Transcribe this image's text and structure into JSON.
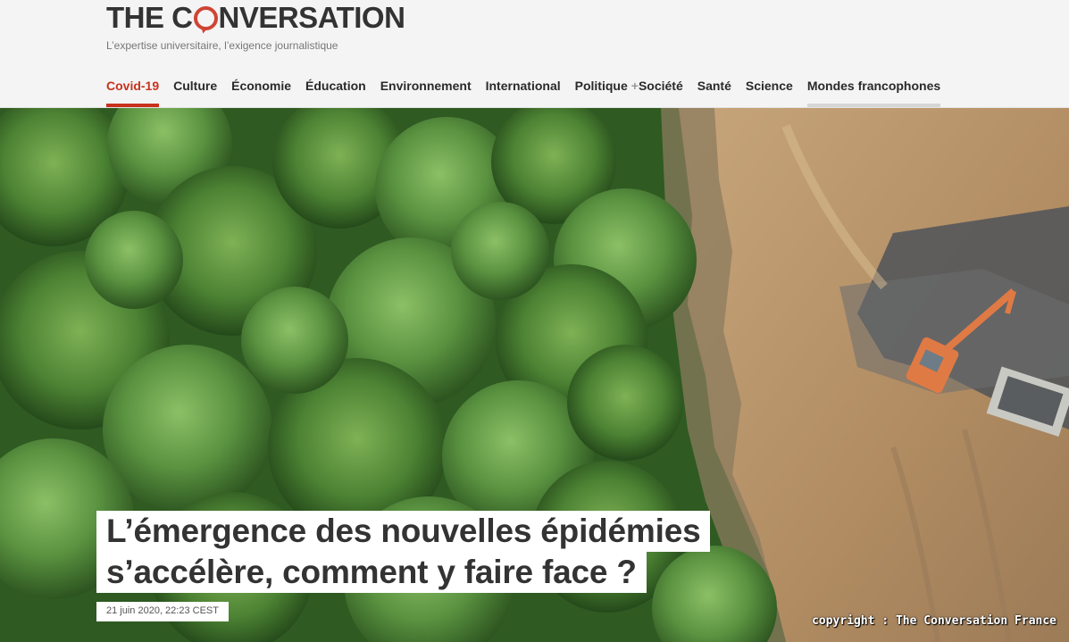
{
  "site": {
    "logo_pre": "THE C",
    "logo_post": "NVERSATION",
    "tagline": "L’expertise universitaire, l’exigence journalistique"
  },
  "nav": {
    "items": [
      {
        "label": "Covid-19",
        "active": true
      },
      {
        "label": "Culture"
      },
      {
        "label": "Économie"
      },
      {
        "label": "Éducation"
      },
      {
        "label": "Environnement"
      },
      {
        "label": "International"
      },
      {
        "label": "Politique",
        "joined_with": "+"
      },
      {
        "label": "Société"
      },
      {
        "label": "Santé"
      },
      {
        "label": "Science"
      },
      {
        "label": "Mondes francophones"
      }
    ],
    "plus_glyph": "+"
  },
  "article": {
    "title_line1": "L’émergence des nouvelles épidémies",
    "title_line2": "s’accélère, comment y faire face ?",
    "date": "21 juin 2020, 22:23 CEST"
  },
  "image": {
    "description_icon": "forest-deforestation-photo",
    "credit": "copyright : The Conversation France"
  },
  "colors": {
    "accent": "#c8321d",
    "logo_red": "#cf4434",
    "text_dark": "#333333",
    "forest": "#3f6b2e",
    "soil": "#b89468"
  }
}
